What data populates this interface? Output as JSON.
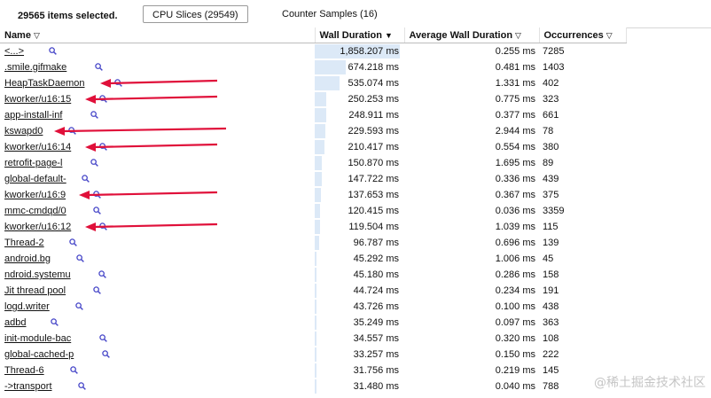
{
  "header": {
    "selection_summary": "29565 items selected.",
    "tabs": [
      {
        "label": "CPU Slices (29549)",
        "active": true
      },
      {
        "label": "Counter Samples (16)",
        "active": false
      }
    ]
  },
  "columns": {
    "name": "Name",
    "wall": "Wall Duration",
    "avg": "Average Wall Duration",
    "occ": "Occurrences",
    "filter_icon": "filter-funnel-icon",
    "sort_icon": "sort-descending-icon"
  },
  "rows": [
    {
      "name": "<...>",
      "wall": "1,858.207 ms",
      "wall_fraction": 1.0,
      "avg": "0.255 ms",
      "occ": "7285",
      "annotated": false
    },
    {
      "name": ".smile.gifmake",
      "wall": "674.218 ms",
      "wall_fraction": 0.363,
      "avg": "0.481 ms",
      "occ": "1403",
      "annotated": false
    },
    {
      "name": "HeapTaskDaemon",
      "wall": "535.074 ms",
      "wall_fraction": 0.288,
      "avg": "1.331 ms",
      "occ": "402",
      "annotated": true
    },
    {
      "name": "kworker/u16:15",
      "wall": "250.253 ms",
      "wall_fraction": 0.135,
      "avg": "0.775 ms",
      "occ": "323",
      "annotated": true
    },
    {
      "name": "app-install-inf",
      "wall": "248.911 ms",
      "wall_fraction": 0.134,
      "avg": "0.377 ms",
      "occ": "661",
      "annotated": false
    },
    {
      "name": "kswapd0",
      "wall": "229.593 ms",
      "wall_fraction": 0.124,
      "avg": "2.944 ms",
      "occ": "78",
      "annotated": true
    },
    {
      "name": "kworker/u16:14",
      "wall": "210.417 ms",
      "wall_fraction": 0.113,
      "avg": "0.554 ms",
      "occ": "380",
      "annotated": true
    },
    {
      "name": "retrofit-page-l",
      "wall": "150.870 ms",
      "wall_fraction": 0.081,
      "avg": "1.695 ms",
      "occ": "89",
      "annotated": false
    },
    {
      "name": "global-default-",
      "wall": "147.722 ms",
      "wall_fraction": 0.079,
      "avg": "0.336 ms",
      "occ": "439",
      "annotated": false
    },
    {
      "name": "kworker/u16:9",
      "wall": "137.653 ms",
      "wall_fraction": 0.074,
      "avg": "0.367 ms",
      "occ": "375",
      "annotated": true
    },
    {
      "name": "mmc-cmdqd/0",
      "wall": "120.415 ms",
      "wall_fraction": 0.065,
      "avg": "0.036 ms",
      "occ": "3359",
      "annotated": false
    },
    {
      "name": "kworker/u16:12",
      "wall": "119.504 ms",
      "wall_fraction": 0.064,
      "avg": "1.039 ms",
      "occ": "115",
      "annotated": true
    },
    {
      "name": "Thread-2",
      "wall": "96.787 ms",
      "wall_fraction": 0.052,
      "avg": "0.696 ms",
      "occ": "139",
      "annotated": false
    },
    {
      "name": "android.bg",
      "wall": "45.292 ms",
      "wall_fraction": 0.024,
      "avg": "1.006 ms",
      "occ": "45",
      "annotated": false
    },
    {
      "name": "ndroid.systemu",
      "wall": "45.180 ms",
      "wall_fraction": 0.024,
      "avg": "0.286 ms",
      "occ": "158",
      "annotated": false
    },
    {
      "name": "Jit thread pool",
      "wall": "44.724 ms",
      "wall_fraction": 0.024,
      "avg": "0.234 ms",
      "occ": "191",
      "annotated": false
    },
    {
      "name": "logd.writer",
      "wall": "43.726 ms",
      "wall_fraction": 0.024,
      "avg": "0.100 ms",
      "occ": "438",
      "annotated": false
    },
    {
      "name": "adbd",
      "wall": "35.249 ms",
      "wall_fraction": 0.019,
      "avg": "0.097 ms",
      "occ": "363",
      "annotated": false
    },
    {
      "name": "init-module-bac",
      "wall": "34.557 ms",
      "wall_fraction": 0.019,
      "avg": "0.320 ms",
      "occ": "108",
      "annotated": false
    },
    {
      "name": "global-cached-p",
      "wall": "33.257 ms",
      "wall_fraction": 0.018,
      "avg": "0.150 ms",
      "occ": "222",
      "annotated": false
    },
    {
      "name": "Thread-6",
      "wall": "31.756 ms",
      "wall_fraction": 0.017,
      "avg": "0.219 ms",
      "occ": "145",
      "annotated": false
    },
    {
      "name": "->transport",
      "wall": "31.480 ms",
      "wall_fraction": 0.017,
      "avg": "0.040 ms",
      "occ": "788",
      "annotated": false
    }
  ],
  "colors": {
    "bar": "#dce9f7",
    "annotation_arrow": "#e0103a",
    "search_icon": "#4646c8"
  },
  "watermark": "@稀土掘金技术社区"
}
